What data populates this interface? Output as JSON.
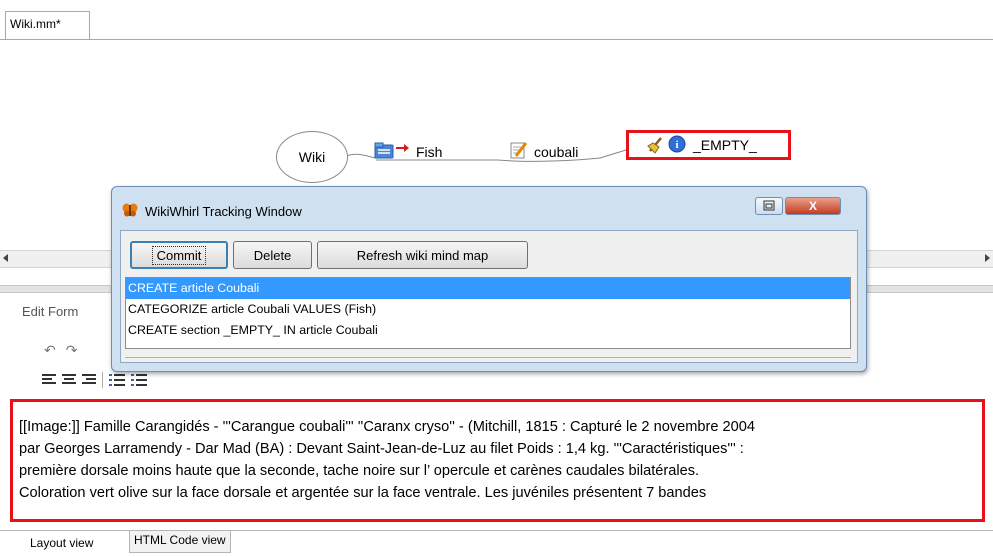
{
  "tab": {
    "label": "Wiki.mm*"
  },
  "mindmap": {
    "root": "Wiki",
    "nodes": [
      {
        "label": "Fish",
        "icon": "folder-arrow-icon"
      },
      {
        "label": "coubali",
        "icon": "edit-note-icon"
      },
      {
        "label": "_EMPTY_",
        "icon": "broom-info-icon"
      }
    ]
  },
  "editor": {
    "menu": "Edit  Form",
    "text_lines": [
      "[[Image:]] Famille Carangidés - '''Carangue coubali''' ''Caranx cryso'' - (Mitchill, 1815 : Capturé le 2 novembre 2004",
      "par Georges Larramendy - Dar Mad (BA) : Devant Saint-Jean-de-Luz au filet Poids : 1,4 kg. '''Caractéristiques''' :",
      "première dorsale moins haute que la seconde, tache noire sur l’ opercule et carènes caudales bilatérales.",
      "Coloration vert olive sur la face dorsale et argentée sur la face ventrale. Les juvéniles présentent 7 bandes"
    ],
    "bottom_tabs": [
      "Layout view",
      "HTML Code view"
    ]
  },
  "dialog": {
    "title": "WikiWhirl Tracking Window",
    "buttons": {
      "commit": "Commit",
      "delete": "Delete",
      "refresh": "Refresh wiki mind map"
    },
    "close_label": "X",
    "operations": [
      "CREATE article Coubali",
      "CATEGORIZE article Coubali VALUES (Fish)",
      "CREATE section _EMPTY_ IN article Coubali"
    ],
    "selected_index": 0
  },
  "colors": {
    "highlight": "#e8111b",
    "selection": "#3399ff"
  }
}
